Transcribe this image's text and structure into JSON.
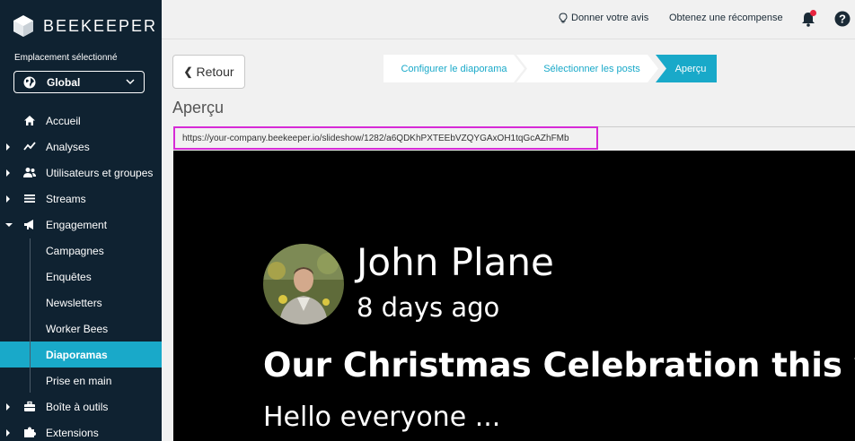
{
  "brand": {
    "name": "BEEKEEPER"
  },
  "location": {
    "label": "Emplacement sélectionné",
    "value": "Global"
  },
  "nav": {
    "items": [
      {
        "label": "Accueil",
        "icon": "home-icon",
        "caret": false
      },
      {
        "label": "Analyses",
        "icon": "chart-icon",
        "caret": true
      },
      {
        "label": "Utilisateurs et groupes",
        "icon": "users-icon",
        "caret": true
      },
      {
        "label": "Streams",
        "icon": "list-icon",
        "caret": true
      },
      {
        "label": "Engagement",
        "icon": "megaphone-icon",
        "caret": true,
        "expanded": true
      }
    ],
    "sub_items": [
      {
        "label": "Campagnes"
      },
      {
        "label": "Enquêtes"
      },
      {
        "label": "Newsletters"
      },
      {
        "label": "Worker Bees"
      },
      {
        "label": "Diaporamas",
        "active": true
      },
      {
        "label": "Prise en main"
      }
    ],
    "bottom_items": [
      {
        "label": "Boîte à outils",
        "icon": "toolbox-icon",
        "caret": true
      },
      {
        "label": "Extensions",
        "icon": "puzzle-icon",
        "caret": true
      }
    ]
  },
  "topbar": {
    "feedback": "Donner votre avis",
    "reward": "Obtenez une récompense"
  },
  "back_label": "Retour",
  "steps": [
    "Configurer le diaporama",
    "Sélectionner les posts",
    "Aperçu"
  ],
  "page_title": "Aperçu",
  "preview_url": "https://your-company.beekeeper.io/slideshow/1282/a6QDKhPXTEEbVZQYGAxOH1tqGcAZhFMb",
  "post": {
    "author": "John Plane",
    "date": "8 days ago",
    "title": "Our Christmas Celebration this year",
    "body": "Hello everyone ..."
  },
  "colors": {
    "sidebar": "#0f2231",
    "accent": "#19a9c9",
    "highlight": "#d62bd6",
    "notification": "#e8243f"
  }
}
